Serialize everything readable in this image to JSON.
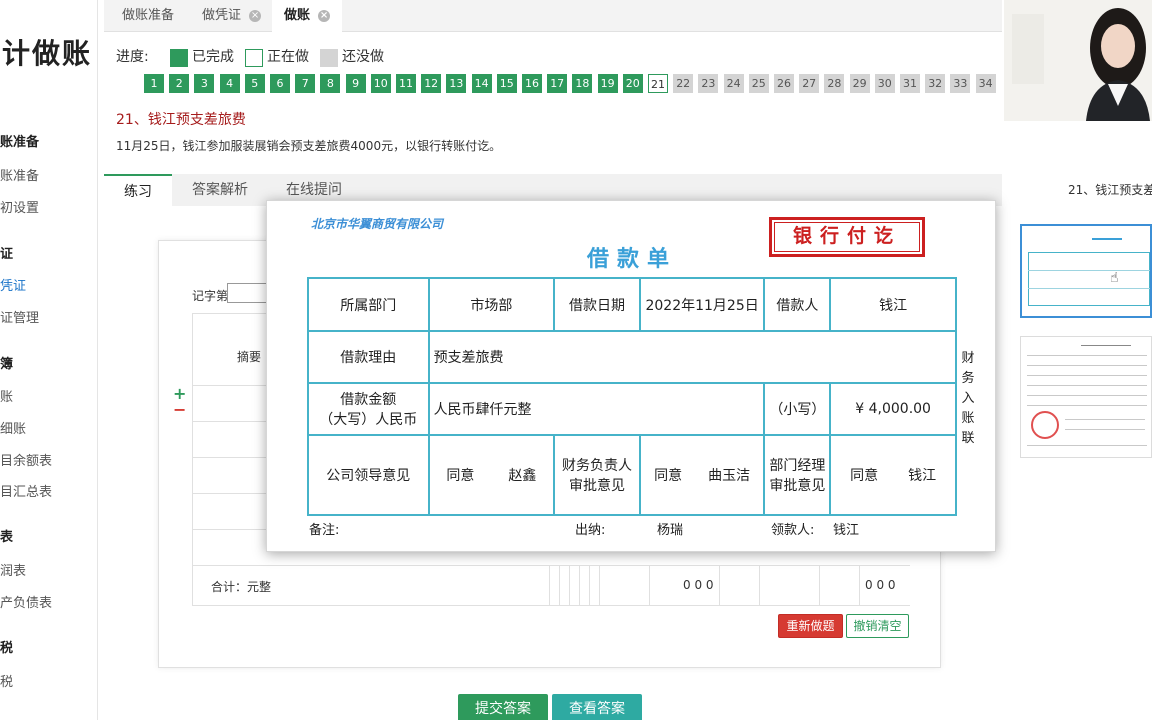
{
  "sidebar": {
    "logo": "会计做账",
    "groups": [
      {
        "label": "账准备",
        "items": [
          "账准备",
          "初设置"
        ]
      },
      {
        "label": "证",
        "items": [
          "凭证",
          "证管理"
        ]
      },
      {
        "label": "簿",
        "items": [
          "账",
          "细账",
          "目余额表",
          "目汇总表"
        ]
      },
      {
        "label": "表",
        "items": [
          "润表",
          "产负债表"
        ]
      },
      {
        "label": "税",
        "items": [
          "税"
        ]
      }
    ]
  },
  "tabs": [
    {
      "label": "做账准备"
    },
    {
      "label": "做凭证",
      "close": "×"
    },
    {
      "label": "做账",
      "close": "×"
    }
  ],
  "progress": {
    "label": "进度:",
    "legend": {
      "done": "已完成",
      "current": "正在做",
      "todo": "还没做"
    },
    "numbers": [
      "1",
      "2",
      "3",
      "4",
      "5",
      "6",
      "7",
      "8",
      "9",
      "10",
      "11",
      "12",
      "13",
      "14",
      "15",
      "16",
      "17",
      "18",
      "19",
      "20",
      "21",
      "22",
      "23",
      "24",
      "25",
      "26",
      "27",
      "28",
      "29",
      "30",
      "31",
      "32",
      "33",
      "34"
    ],
    "current": 21,
    "colors": {
      "done": "#2e9a5c",
      "todo": "#d4d4d4"
    }
  },
  "question": {
    "title": "21、钱江预支差旅费",
    "desc": "11月25日，钱江参加服装展销会预支差旅费4000元，以银行转账付讫。"
  },
  "work_tabs": [
    "练习",
    "答案解析",
    "在线提问"
  ],
  "voucher": {
    "word_label": "记字第",
    "summary_header": "摘要",
    "plus": "+",
    "minus": "−",
    "total_label": "合计：元整",
    "debit_zeros": "0 0 0",
    "credit_zeros": "0 0 0",
    "redo": "重新做题",
    "clear": "撤销清空"
  },
  "actions": {
    "submit": "提交答案",
    "view": "查看答案"
  },
  "loan_slip": {
    "company": "北京市华翼商贸有限公司",
    "title": "借款单",
    "stamp": "银行付讫",
    "rows": {
      "dept_label": "所属部门",
      "dept": "市场部",
      "date_label": "借款日期",
      "date": "2022年11月25日",
      "borrower_label": "借款人",
      "borrower": "钱江",
      "reason_label": "借款理由",
      "reason": "预支差旅费",
      "amount_label_1": "借款金额",
      "amount_label_2": "（大写）人民币",
      "amount_upper": "人民币肆仟元整",
      "small_label": "（小写）",
      "amount_small": "¥ 4,000.00",
      "leader_label": "公司领导意见",
      "leader_opinion": "同意",
      "leader_name": "赵鑫",
      "finance_label_1": "财务负责人",
      "finance_label_2": "审批意见",
      "finance_opinion": "同意",
      "finance_name": "曲玉洁",
      "manager_label_1": "部门经理",
      "manager_label_2": "审批意见",
      "manager_opinion": "同意",
      "manager_name": "钱江"
    },
    "side": [
      "财",
      "务",
      "入",
      "账",
      "联"
    ],
    "footer": {
      "note_label": "备注:",
      "cashier_label": "出纳:",
      "cashier": "杨瑞",
      "receiver_label": "领款人:",
      "receiver": "钱江"
    }
  },
  "right_panel": {
    "title": "21、钱江预支差"
  }
}
